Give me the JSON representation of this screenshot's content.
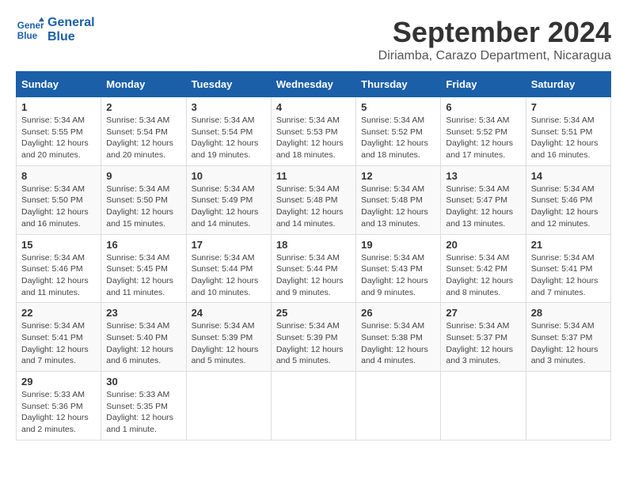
{
  "logo": {
    "line1": "General",
    "line2": "Blue"
  },
  "title": "September 2024",
  "subtitle": "Diriamba, Carazo Department, Nicaragua",
  "headers": [
    "Sunday",
    "Monday",
    "Tuesday",
    "Wednesday",
    "Thursday",
    "Friday",
    "Saturday"
  ],
  "weeks": [
    [
      {
        "day": "1",
        "info": "Sunrise: 5:34 AM\nSunset: 5:55 PM\nDaylight: 12 hours\nand 20 minutes."
      },
      {
        "day": "2",
        "info": "Sunrise: 5:34 AM\nSunset: 5:54 PM\nDaylight: 12 hours\nand 20 minutes."
      },
      {
        "day": "3",
        "info": "Sunrise: 5:34 AM\nSunset: 5:54 PM\nDaylight: 12 hours\nand 19 minutes."
      },
      {
        "day": "4",
        "info": "Sunrise: 5:34 AM\nSunset: 5:53 PM\nDaylight: 12 hours\nand 18 minutes."
      },
      {
        "day": "5",
        "info": "Sunrise: 5:34 AM\nSunset: 5:52 PM\nDaylight: 12 hours\nand 18 minutes."
      },
      {
        "day": "6",
        "info": "Sunrise: 5:34 AM\nSunset: 5:52 PM\nDaylight: 12 hours\nand 17 minutes."
      },
      {
        "day": "7",
        "info": "Sunrise: 5:34 AM\nSunset: 5:51 PM\nDaylight: 12 hours\nand 16 minutes."
      }
    ],
    [
      {
        "day": "8",
        "info": "Sunrise: 5:34 AM\nSunset: 5:50 PM\nDaylight: 12 hours\nand 16 minutes."
      },
      {
        "day": "9",
        "info": "Sunrise: 5:34 AM\nSunset: 5:50 PM\nDaylight: 12 hours\nand 15 minutes."
      },
      {
        "day": "10",
        "info": "Sunrise: 5:34 AM\nSunset: 5:49 PM\nDaylight: 12 hours\nand 14 minutes."
      },
      {
        "day": "11",
        "info": "Sunrise: 5:34 AM\nSunset: 5:48 PM\nDaylight: 12 hours\nand 14 minutes."
      },
      {
        "day": "12",
        "info": "Sunrise: 5:34 AM\nSunset: 5:48 PM\nDaylight: 12 hours\nand 13 minutes."
      },
      {
        "day": "13",
        "info": "Sunrise: 5:34 AM\nSunset: 5:47 PM\nDaylight: 12 hours\nand 13 minutes."
      },
      {
        "day": "14",
        "info": "Sunrise: 5:34 AM\nSunset: 5:46 PM\nDaylight: 12 hours\nand 12 minutes."
      }
    ],
    [
      {
        "day": "15",
        "info": "Sunrise: 5:34 AM\nSunset: 5:46 PM\nDaylight: 12 hours\nand 11 minutes."
      },
      {
        "day": "16",
        "info": "Sunrise: 5:34 AM\nSunset: 5:45 PM\nDaylight: 12 hours\nand 11 minutes."
      },
      {
        "day": "17",
        "info": "Sunrise: 5:34 AM\nSunset: 5:44 PM\nDaylight: 12 hours\nand 10 minutes."
      },
      {
        "day": "18",
        "info": "Sunrise: 5:34 AM\nSunset: 5:44 PM\nDaylight: 12 hours\nand 9 minutes."
      },
      {
        "day": "19",
        "info": "Sunrise: 5:34 AM\nSunset: 5:43 PM\nDaylight: 12 hours\nand 9 minutes."
      },
      {
        "day": "20",
        "info": "Sunrise: 5:34 AM\nSunset: 5:42 PM\nDaylight: 12 hours\nand 8 minutes."
      },
      {
        "day": "21",
        "info": "Sunrise: 5:34 AM\nSunset: 5:41 PM\nDaylight: 12 hours\nand 7 minutes."
      }
    ],
    [
      {
        "day": "22",
        "info": "Sunrise: 5:34 AM\nSunset: 5:41 PM\nDaylight: 12 hours\nand 7 minutes."
      },
      {
        "day": "23",
        "info": "Sunrise: 5:34 AM\nSunset: 5:40 PM\nDaylight: 12 hours\nand 6 minutes."
      },
      {
        "day": "24",
        "info": "Sunrise: 5:34 AM\nSunset: 5:39 PM\nDaylight: 12 hours\nand 5 minutes."
      },
      {
        "day": "25",
        "info": "Sunrise: 5:34 AM\nSunset: 5:39 PM\nDaylight: 12 hours\nand 5 minutes."
      },
      {
        "day": "26",
        "info": "Sunrise: 5:34 AM\nSunset: 5:38 PM\nDaylight: 12 hours\nand 4 minutes."
      },
      {
        "day": "27",
        "info": "Sunrise: 5:34 AM\nSunset: 5:37 PM\nDaylight: 12 hours\nand 3 minutes."
      },
      {
        "day": "28",
        "info": "Sunrise: 5:34 AM\nSunset: 5:37 PM\nDaylight: 12 hours\nand 3 minutes."
      }
    ],
    [
      {
        "day": "29",
        "info": "Sunrise: 5:33 AM\nSunset: 5:36 PM\nDaylight: 12 hours\nand 2 minutes."
      },
      {
        "day": "30",
        "info": "Sunrise: 5:33 AM\nSunset: 5:35 PM\nDaylight: 12 hours\nand 1 minute."
      },
      {
        "day": "",
        "info": ""
      },
      {
        "day": "",
        "info": ""
      },
      {
        "day": "",
        "info": ""
      },
      {
        "day": "",
        "info": ""
      },
      {
        "day": "",
        "info": ""
      }
    ]
  ]
}
